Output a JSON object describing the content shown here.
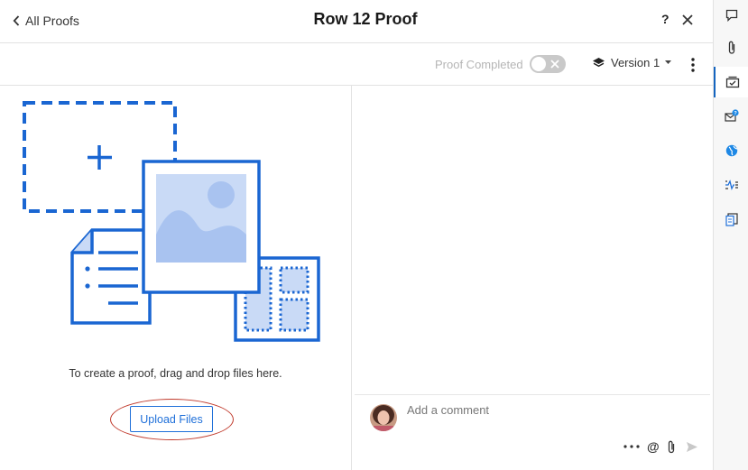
{
  "header": {
    "back_label": "All Proofs",
    "title": "Row 12 Proof",
    "help_label": "?"
  },
  "toolbar": {
    "proof_completed_label": "Proof Completed",
    "proof_completed": false,
    "version_label": "Version 1"
  },
  "dropzone": {
    "hint_text": "To create a proof, drag and drop files here.",
    "upload_label": "Upload Files"
  },
  "comment": {
    "placeholder": "Add a comment",
    "at_label": "@"
  },
  "rail": {
    "items": [
      {
        "icon": "comment-icon"
      },
      {
        "icon": "attachment-icon"
      },
      {
        "icon": "proof-icon",
        "active": true
      },
      {
        "icon": "update-requests-icon",
        "badge": "?"
      },
      {
        "icon": "globe-icon"
      },
      {
        "icon": "activity-icon"
      },
      {
        "icon": "summary-icon"
      }
    ]
  },
  "colors": {
    "accent": "#1565c0",
    "illustration_blue": "#1a66d2",
    "illustration_light": "#c9daf6",
    "annotation_oval": "#c0392b"
  }
}
